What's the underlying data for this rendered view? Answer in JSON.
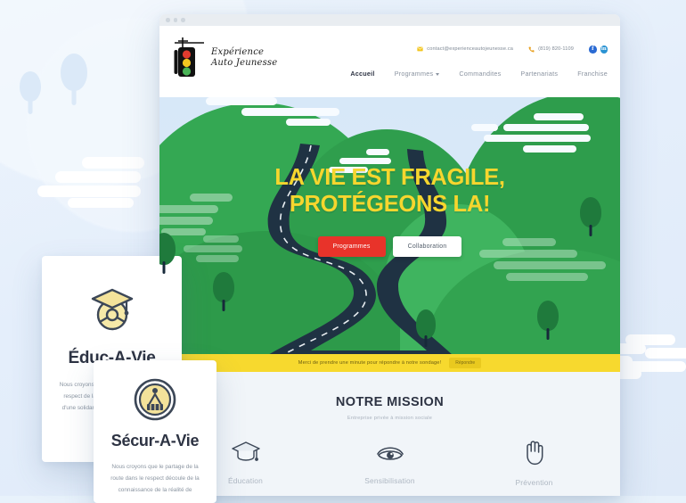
{
  "site": {
    "brand": {
      "name_line1": "Expérience",
      "name_line2": "Auto Jeunesse",
      "logo_icon": "traffic-light-icon"
    },
    "topbar": {
      "email": "contact@experienceautojeunesse.ca",
      "email_icon": "mail-icon",
      "phone": "(819) 820-1109",
      "phone_icon": "phone-icon",
      "social": [
        {
          "name": "facebook-icon",
          "glyph": "f",
          "color": "#2a6ad3"
        },
        {
          "name": "linkedin-icon",
          "glyph": "in",
          "color": "#2a93d3"
        }
      ]
    },
    "nav": [
      {
        "label": "Accueil",
        "active": true,
        "caret": false
      },
      {
        "label": "Programmes",
        "active": false,
        "caret": true
      },
      {
        "label": "Commandites",
        "active": false,
        "caret": false
      },
      {
        "label": "Partenariats",
        "active": false,
        "caret": false
      },
      {
        "label": "Franchise",
        "active": false,
        "caret": false
      }
    ]
  },
  "hero": {
    "headline_line1": "LA VIE EST FRAGILE,",
    "headline_line2": "PROTÉGEONS LA!",
    "headline_color": "#f6d62e",
    "buttons": [
      {
        "label": "Programmes",
        "style": "primary",
        "color": "#e8332a"
      },
      {
        "label": "Collaboration",
        "style": "secondary",
        "color": "#ffffff"
      }
    ]
  },
  "survey": {
    "message": "Merci de prendre une minute pour répondre à notre sondage!",
    "button_label": "Répondre",
    "bar_color": "#f7d92e"
  },
  "mission": {
    "title": "NOTRE MISSION",
    "subtitle": "Entreprise privée à mission sociale",
    "features": [
      {
        "label": "Éducation",
        "icon": "graduation-cap-icon"
      },
      {
        "label": "Sensibilisation",
        "icon": "eye-icon"
      },
      {
        "label": "Prévention",
        "icon": "hand-stop-icon"
      }
    ]
  },
  "cards": [
    {
      "title": "Éduc-A-Vie",
      "icon": "graduation-cap-steering-wheel-icon",
      "body": "Nous croyons que la compréhension et le respect de la sécurité routière découle d'une solidarité entre conducteurs et un partage"
    },
    {
      "title": "Sécur-A-Vie",
      "icon": "seatbelt-badge-icon",
      "body": "Nous croyons que le partage de la route dans le respect découle de la connaissance de la réalité de"
    }
  ],
  "browser": {
    "dots": [
      "#cfd6dd",
      "#cfd6dd",
      "#cfd6dd"
    ]
  }
}
